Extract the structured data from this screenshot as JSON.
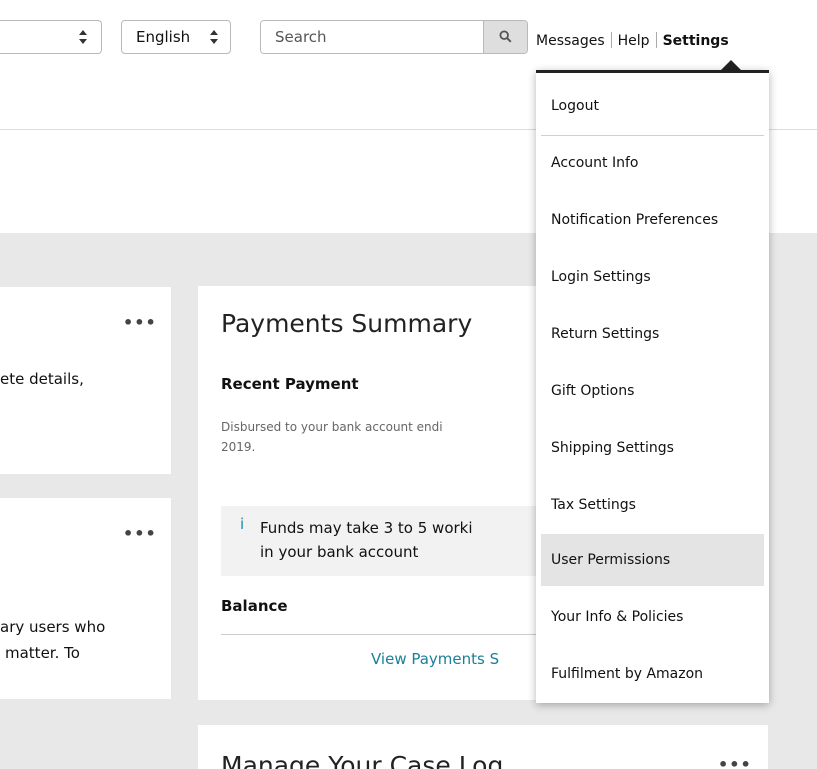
{
  "header": {
    "language_select": "English",
    "search_placeholder": "Search",
    "links": {
      "messages": "Messages",
      "help": "Help",
      "settings": "Settings"
    }
  },
  "cards": {
    "left_top": {
      "dots": "•••",
      "text": "ete details,"
    },
    "left_bottom": {
      "dots": "•••",
      "line1": "ary users who",
      "line2": "matter. To"
    },
    "payments": {
      "title": "Payments Summary",
      "recent_label": "Recent Payment",
      "disbursed_line1": "Disbursed to your bank account endi",
      "disbursed_line2": "2019.",
      "notice_icon": "i",
      "notice_line1": "Funds may take 3 to 5 worki",
      "notice_line2": "in your bank account",
      "balance_label": "Balance",
      "view_link": "View Payments S"
    },
    "case_log": {
      "title": "Manage Your Case Log",
      "dots": "•••"
    }
  },
  "settings_menu": {
    "items": [
      "Logout",
      "Account Info",
      "Notification Preferences",
      "Login Settings",
      "Return Settings",
      "Gift Options",
      "Shipping Settings",
      "Tax Settings",
      "User Permissions",
      "Your Info & Policies",
      "Fulfilment by Amazon"
    ],
    "highlighted_item": "User Permissions"
  },
  "colors": {
    "link_teal": "#1a7f9a",
    "info_icon": "#1a8aa8",
    "content_background": "#e8e8e8",
    "menu_highlight": "#e4e4e4"
  },
  "icons": {
    "search": "search-icon",
    "select_arrows": "up-down-arrows-icon",
    "info": "info-icon",
    "overflow": "more-options-icon"
  }
}
